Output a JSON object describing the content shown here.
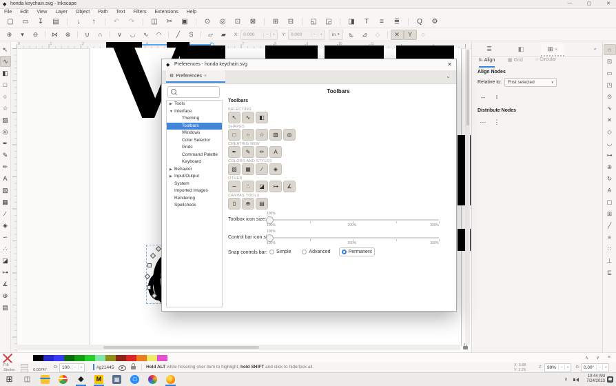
{
  "titlebar": {
    "title": "honda keychain.svg - Inkscape",
    "minimize": "—",
    "maximize": "▢",
    "close": "✕"
  },
  "menubar": {
    "items": [
      "File",
      "Edit",
      "View",
      "Layer",
      "Object",
      "Path",
      "Text",
      "Filters",
      "Extensions",
      "Help"
    ]
  },
  "command_bar": {
    "icons": [
      {
        "name": "new-document-button",
        "glyph": "▢"
      },
      {
        "name": "open-document-button",
        "glyph": "▭"
      },
      {
        "name": "save-document-button",
        "glyph": "↧"
      },
      {
        "name": "print-button",
        "glyph": "▤"
      },
      {
        "type": "sep"
      },
      {
        "name": "import-button",
        "glyph": "↓"
      },
      {
        "name": "export-button",
        "glyph": "↑"
      },
      {
        "type": "sep"
      },
      {
        "name": "undo-button",
        "glyph": "↶",
        "disabled": true
      },
      {
        "name": "redo-button",
        "glyph": "↷",
        "disabled": true
      },
      {
        "type": "sep"
      },
      {
        "name": "copy-button",
        "glyph": "◫"
      },
      {
        "name": "cut-button",
        "glyph": "✂"
      },
      {
        "name": "paste-button",
        "glyph": "▣"
      },
      {
        "type": "sep"
      },
      {
        "name": "zoom-selection-button",
        "glyph": "⊙"
      },
      {
        "name": "zoom-drawing-button",
        "glyph": "◎"
      },
      {
        "name": "zoom-page-button",
        "glyph": "⊡"
      },
      {
        "name": "zoom-fit-button",
        "glyph": "⊠"
      },
      {
        "type": "sep"
      },
      {
        "name": "duplicate-button",
        "glyph": "⊞"
      },
      {
        "name": "clone-button",
        "glyph": "⊟"
      },
      {
        "type": "sep"
      },
      {
        "name": "group-button",
        "glyph": "◱"
      },
      {
        "name": "ungroup-button",
        "glyph": "◲"
      },
      {
        "type": "sep"
      },
      {
        "name": "fill-stroke-dialog-button",
        "glyph": "◨"
      },
      {
        "name": "text-dialog-button",
        "glyph": "T"
      },
      {
        "name": "layers-dialog-button",
        "glyph": "≡"
      },
      {
        "name": "align-dialog-button",
        "glyph": "≣"
      },
      {
        "type": "sep"
      },
      {
        "name": "find-replace-button",
        "glyph": "Q"
      },
      {
        "name": "preferences-button",
        "glyph": "⚙"
      }
    ]
  },
  "tool_controls": {
    "icons_left": [
      {
        "name": "insert-node-button",
        "glyph": "⊕"
      },
      {
        "name": "insert-node-options-button",
        "glyph": "▾"
      },
      {
        "name": "delete-node-button",
        "glyph": "⊖"
      },
      {
        "type": "sep"
      },
      {
        "name": "join-nodes-button",
        "glyph": "⋈"
      },
      {
        "name": "break-nodes-button",
        "glyph": "⊗"
      },
      {
        "type": "sep"
      },
      {
        "name": "join-segment-button",
        "glyph": "∪"
      },
      {
        "name": "delete-segment-button",
        "glyph": "∩"
      },
      {
        "type": "sep"
      },
      {
        "name": "corner-node-button",
        "glyph": "∨"
      },
      {
        "name": "smooth-node-button",
        "glyph": "◡"
      },
      {
        "name": "symmetric-node-button",
        "glyph": "∿"
      },
      {
        "name": "auto-smooth-node-button",
        "glyph": "◠"
      },
      {
        "type": "sep"
      },
      {
        "name": "make-line-button",
        "glyph": "╱"
      },
      {
        "name": "make-curve-button",
        "glyph": "S"
      },
      {
        "type": "sep"
      },
      {
        "name": "object-to-path-button",
        "glyph": "▱"
      },
      {
        "name": "stroke-to-path-button",
        "glyph": "▰"
      }
    ],
    "x_label": "X:",
    "x_value": "0.000",
    "y_label": "Y:",
    "y_value": "0.000",
    "unit_value": "in",
    "unit_caret": "▾",
    "minus": "−",
    "plus": "+",
    "icons_right": [
      {
        "name": "edit-clip-path-button",
        "glyph": "⊾"
      },
      {
        "name": "edit-mask-button",
        "glyph": "⊿"
      },
      {
        "name": "next-path-effect-button",
        "glyph": "◇",
        "disabled": true
      },
      {
        "type": "sep"
      },
      {
        "name": "show-transform-handles-button",
        "glyph": "✕",
        "active": true
      },
      {
        "name": "show-bezier-handles-button",
        "glyph": "Y",
        "active": true
      },
      {
        "name": "show-outline-button",
        "glyph": "◌"
      }
    ]
  },
  "toolbox": {
    "tools": [
      {
        "name": "selector-tool",
        "glyph": "↖"
      },
      {
        "name": "node-tool",
        "glyph": "∿",
        "selected": true
      },
      {
        "name": "shape-builder-tool",
        "glyph": "◧"
      },
      {
        "name": "rectangle-tool",
        "glyph": "□"
      },
      {
        "name": "ellipse-tool",
        "glyph": "○"
      },
      {
        "name": "star-tool",
        "glyph": "☆"
      },
      {
        "name": "box-3d-tool",
        "glyph": "▧"
      },
      {
        "name": "spiral-tool",
        "glyph": "◎"
      },
      {
        "name": "pen-tool",
        "glyph": "✒"
      },
      {
        "name": "pencil-tool",
        "glyph": "✎"
      },
      {
        "name": "calligraphy-tool",
        "glyph": "✏"
      },
      {
        "name": "text-tool",
        "glyph": "A"
      },
      {
        "name": "gradient-tool",
        "glyph": "▨"
      },
      {
        "name": "mesh-tool",
        "glyph": "▦"
      },
      {
        "name": "dropper-tool",
        "glyph": "∕"
      },
      {
        "name": "paint-bucket-tool",
        "glyph": "◈"
      },
      {
        "name": "tweak-tool",
        "glyph": "∽"
      },
      {
        "name": "spray-tool",
        "glyph": "∴"
      },
      {
        "name": "eraser-tool",
        "glyph": "◪"
      },
      {
        "name": "connector-tool",
        "glyph": "⊶"
      },
      {
        "name": "measure-tool",
        "glyph": "∡"
      },
      {
        "name": "zoom-tool",
        "glyph": "⊕"
      },
      {
        "name": "pages-tool",
        "glyph": "▤"
      }
    ]
  },
  "snap_bar": {
    "icons": [
      {
        "name": "enable-snapping-toggle",
        "glyph": "∩",
        "active": true
      },
      {
        "name": "snap-bounding-box",
        "glyph": "⊡"
      },
      {
        "name": "snap-bbox-edges",
        "glyph": "▭"
      },
      {
        "name": "snap-bbox-corners",
        "glyph": "◳"
      },
      {
        "name": "snap-nodes",
        "glyph": "⊙"
      },
      {
        "name": "snap-paths",
        "glyph": "∿"
      },
      {
        "name": "snap-path-intersections",
        "glyph": "✕"
      },
      {
        "name": "snap-cusp-nodes",
        "glyph": "◇"
      },
      {
        "name": "snap-smooth-nodes",
        "glyph": "◡"
      },
      {
        "name": "snap-midpoints",
        "glyph": "⊶"
      },
      {
        "name": "snap-object-centers",
        "glyph": "⊕"
      },
      {
        "name": "snap-rotation-centers",
        "glyph": "↻"
      },
      {
        "name": "snap-text-baselines",
        "glyph": "A"
      },
      {
        "name": "snap-page-border",
        "glyph": "▢"
      },
      {
        "name": "snap-grids",
        "glyph": "⊞"
      },
      {
        "name": "snap-guides",
        "glyph": "╱"
      },
      {
        "name": "snap-alignment",
        "glyph": "≡"
      },
      {
        "name": "snap-distribution",
        "glyph": "∷"
      },
      {
        "name": "snap-perpendicular",
        "glyph": "⊥"
      },
      {
        "name": "snap-settings",
        "glyph": "⊑"
      }
    ]
  },
  "canvas": {
    "ruler_numbers": [
      "0",
      "1",
      "2",
      "3",
      "4",
      "5",
      "6",
      "7",
      "8",
      "9",
      "10",
      "11"
    ]
  },
  "preferences_dialog": {
    "title": "Preferences - honda keychain.svg",
    "close": "✕",
    "tab_label": "Preferences",
    "tab_close": "×",
    "tab_chevron": "⌄",
    "heading": "Toolbars",
    "tree": [
      {
        "name": "tree-item-tools",
        "label": "Tools",
        "arrow": "▶",
        "level": 0
      },
      {
        "name": "tree-item-interface",
        "label": "Interface",
        "arrow": "▼",
        "level": 0
      },
      {
        "name": "tree-item-theming",
        "label": "Theming",
        "arrow": "",
        "level": 1
      },
      {
        "name": "tree-item-toolbars",
        "label": "Toolbars",
        "arrow": "",
        "level": 1,
        "selected": true
      },
      {
        "name": "tree-item-windows",
        "label": "Windows",
        "arrow": "",
        "level": 1
      },
      {
        "name": "tree-item-color-selector",
        "label": "Color Selector",
        "arrow": "",
        "level": 1
      },
      {
        "name": "tree-item-grids",
        "label": "Grids",
        "arrow": "",
        "level": 1
      },
      {
        "name": "tree-item-command-palette",
        "label": "Command Palette",
        "arrow": "",
        "level": 1
      },
      {
        "name": "tree-item-keyboard",
        "label": "Keyboard",
        "arrow": "",
        "level": 1
      },
      {
        "name": "tree-item-behavior",
        "label": "Behavior",
        "arrow": "▶",
        "level": 0
      },
      {
        "name": "tree-item-input-output",
        "label": "Input/Output",
        "arrow": "▶",
        "level": 0
      },
      {
        "name": "tree-item-system",
        "label": "System",
        "arrow": "",
        "level": 0
      },
      {
        "name": "tree-item-imported-images",
        "label": "Imported Images",
        "arrow": "",
        "level": 0
      },
      {
        "name": "tree-item-rendering",
        "label": "Rendering",
        "arrow": "",
        "level": 0
      },
      {
        "name": "tree-item-spellcheck",
        "label": "Spellcheck",
        "arrow": "",
        "level": 0
      }
    ],
    "panel_title": "Toolbars",
    "group_selecting": {
      "label": "SELECTING",
      "buttons": [
        {
          "name": "toggle-selector-tool",
          "glyph": "↖"
        },
        {
          "name": "toggle-node-tool",
          "glyph": "∿"
        },
        {
          "name": "toggle-shape-builder-tool",
          "glyph": "◧"
        }
      ]
    },
    "group_shapes": {
      "label": "SHAPES",
      "buttons": [
        {
          "name": "toggle-rectangle-tool",
          "glyph": "□"
        },
        {
          "name": "toggle-ellipse-tool",
          "glyph": "○"
        },
        {
          "name": "toggle-star-tool",
          "glyph": "☆"
        },
        {
          "name": "toggle-box-3d-tool",
          "glyph": "▧"
        },
        {
          "name": "toggle-spiral-tool",
          "glyph": "◎"
        }
      ]
    },
    "group_creating": {
      "label": "CREATING NEW",
      "buttons": [
        {
          "name": "toggle-pen-tool",
          "glyph": "✒"
        },
        {
          "name": "toggle-pencil-tool",
          "glyph": "✎"
        },
        {
          "name": "toggle-calligraphy-tool",
          "glyph": "✏"
        },
        {
          "name": "toggle-text-tool",
          "glyph": "A"
        }
      ]
    },
    "group_colors": {
      "label": "COLORS AND STYLES",
      "buttons": [
        {
          "name": "toggle-gradient-tool",
          "glyph": "▨"
        },
        {
          "name": "toggle-mesh-tool",
          "glyph": "▦"
        },
        {
          "name": "toggle-dropper-tool",
          "glyph": "∕"
        },
        {
          "name": "toggle-paint-bucket-tool",
          "glyph": "◈"
        }
      ]
    },
    "group_other": {
      "label": "OTHER",
      "buttons": [
        {
          "name": "toggle-tweak-tool",
          "glyph": "∽"
        },
        {
          "name": "toggle-spray-tool",
          "glyph": "∴"
        },
        {
          "name": "toggle-eraser-tool",
          "glyph": "◪"
        },
        {
          "name": "toggle-connector-tool",
          "glyph": "⊶"
        },
        {
          "name": "toggle-measure-tool",
          "glyph": "∡"
        }
      ]
    },
    "group_canvas": {
      "label": "CANVAS TOOLS",
      "buttons": [
        {
          "name": "toggle-pan-tool",
          "glyph": "▯"
        },
        {
          "name": "toggle-zoom-tool",
          "glyph": "⊕"
        },
        {
          "name": "toggle-pages-tool",
          "glyph": "▤"
        }
      ]
    },
    "toolbox_slider": {
      "label": "Toolbox icon size:",
      "value": "100%",
      "tick_min": "100%",
      "tick_mid": "200%",
      "tick_max": "300%"
    },
    "controlbar_slider": {
      "label": "Control bar icon size:",
      "value": "100%",
      "tick_min": "100%",
      "tick_mid": "200%",
      "tick_max": "300%"
    },
    "snap_radio": {
      "label": "Snap controls bar:",
      "options": [
        {
          "name": "radio-simple",
          "label": "Simple",
          "selected": false
        },
        {
          "name": "radio-advanced",
          "label": "Advanced",
          "selected": false
        },
        {
          "name": "radio-permanent",
          "label": "Permanent",
          "selected": true
        }
      ]
    }
  },
  "dock": {
    "tabs": [
      {
        "name": "dock-tab-objects",
        "glyph": "≣"
      },
      {
        "name": "dock-tab-fill-stroke",
        "glyph": "◧"
      },
      {
        "name": "dock-tab-align",
        "glyph": "⊞",
        "active": true
      }
    ],
    "tab_close": "×",
    "tab_chevron": "⌄",
    "subtabs": [
      {
        "name": "subtab-align",
        "label": "Align",
        "active": true
      },
      {
        "name": "subtab-grid",
        "label": "Grid",
        "active": false
      },
      {
        "name": "subtab-circular",
        "label": "Circular",
        "active": false
      }
    ],
    "align_nodes_label": "Align Nodes",
    "relative_to_label": "Relative to:",
    "relative_to_value": "First selected",
    "relative_to_caret": "▾",
    "align_buttons": [
      {
        "name": "align-nodes-horizontally-button",
        "glyph": "↔"
      },
      {
        "name": "align-nodes-vertically-button",
        "glyph": "↕"
      }
    ],
    "distribute_nodes_label": "Distribute Nodes",
    "distribute_buttons": [
      {
        "name": "distribute-nodes-horizontally-button",
        "glyph": "⋯"
      },
      {
        "name": "distribute-nodes-vertically-button",
        "glyph": "⋮"
      }
    ]
  },
  "palette": {
    "swatches": [
      {
        "name": "swatch-black",
        "color": "#000000"
      },
      {
        "name": "swatch-dark-blue",
        "color": "#2929c9"
      },
      {
        "name": "swatch-blue",
        "color": "#3a3aff"
      },
      {
        "name": "swatch-dark-green",
        "color": "#0c6e0c"
      },
      {
        "name": "swatch-green",
        "color": "#12a012"
      },
      {
        "name": "swatch-bright-green",
        "color": "#28cf28"
      },
      {
        "name": "swatch-mint",
        "color": "#7fe8a8"
      },
      {
        "name": "swatch-olive",
        "color": "#8f8f19"
      },
      {
        "name": "swatch-dark-red",
        "color": "#8f2419"
      },
      {
        "name": "swatch-red",
        "color": "#de2424"
      },
      {
        "name": "swatch-orange",
        "color": "#ea7e1f"
      },
      {
        "name": "swatch-yellow",
        "color": "#f2e96b"
      },
      {
        "name": "swatch-magenta",
        "color": "#e84ed4"
      }
    ],
    "scroll_up": "∧",
    "scroll_down": "∨",
    "menu": "≡"
  },
  "status_bar": {
    "fill_label": "Fill:",
    "stroke_label": "Stroke:",
    "stroke_width": "0.00747",
    "opacity_label": "O:",
    "opacity_value": "100",
    "minus": "−",
    "plus": "+",
    "layer_id": "#g21445",
    "hint_bold1": "Hold ALT",
    "hint_text1": " while hovering over item to highlight, ",
    "hint_bold2": "hold SHIFT",
    "hint_text2": " and click to hide/lock all.",
    "x_label": "X:",
    "x_value": "3.68",
    "y_label": "Y:",
    "y_value": "1.76",
    "zoom_label": "Z:",
    "zoom_value": "99%",
    "rotation_label": "R:",
    "rotation_value": "0.00°"
  },
  "taskbar": {
    "apps": [
      {
        "name": "start-button",
        "icon": "start",
        "glyph": "⊞"
      },
      {
        "name": "task-view-button",
        "icon": "taskview",
        "glyph": "◫"
      },
      {
        "name": "file-explorer-app",
        "icon": "explorer",
        "glyph": "",
        "active": true
      },
      {
        "name": "chrome-app",
        "icon": "chrome",
        "glyph": "",
        "active": true
      },
      {
        "name": "inkscape-app",
        "icon": "inkscape",
        "glyph": "◆",
        "active": true
      },
      {
        "name": "m-app",
        "icon": "mapp",
        "glyph": "M",
        "active": true
      },
      {
        "name": "calculator-app",
        "icon": "calc",
        "glyph": "▦"
      },
      {
        "name": "zoom-app",
        "icon": "zoomapp",
        "glyph": "▢"
      },
      {
        "name": "photos-app",
        "icon": "photos",
        "glyph": ""
      },
      {
        "name": "firefox-app",
        "icon": "firefox",
        "glyph": "",
        "active": true
      }
    ],
    "tray_chevron": "∧",
    "time": "10:44 AM",
    "date": "7/24/2023"
  }
}
